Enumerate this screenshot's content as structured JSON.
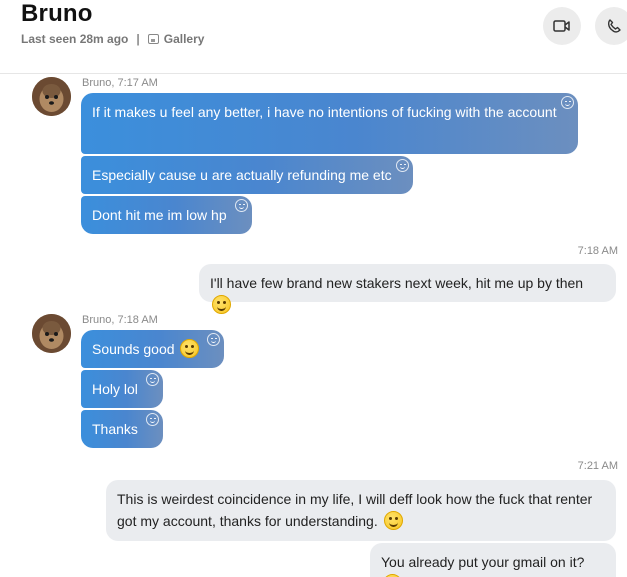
{
  "header": {
    "contact_name": "Bruno",
    "last_seen": "Last seen 28m ago",
    "separator": "|",
    "gallery_label": "Gallery"
  },
  "conversation": {
    "group1": {
      "sender": "Bruno, 7:17 AM",
      "messages": [
        "If it makes u feel any better, i have no intentions of fucking with the account",
        "Especially cause u are actually refunding me etc",
        "Dont hit me im low hp"
      ]
    },
    "outgoing1": {
      "time": "7:18 AM",
      "text": "I'll have few brand new stakers next week, hit me up by then"
    },
    "group2": {
      "sender": "Bruno, 7:18 AM",
      "messages": [
        "Sounds good",
        "Holy lol",
        "Thanks"
      ]
    },
    "outgoing2": {
      "time": "7:21 AM",
      "text": "This is weirdest coincidence in my life, I will deff look how the fuck that renter got my account, thanks for understanding."
    },
    "outgoing3": {
      "text": "You already put your gmail on it?"
    }
  },
  "colors": {
    "incoming_start": "#3b8fdc",
    "incoming_end": "#6c8fbf",
    "outgoing_bg": "#eaecef"
  }
}
